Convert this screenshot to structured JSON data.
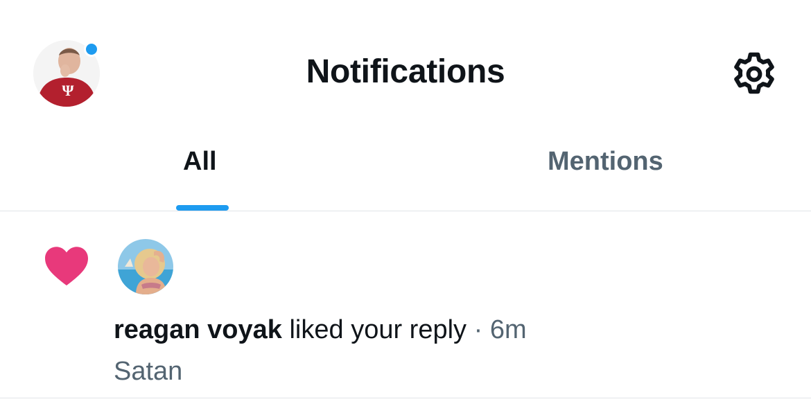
{
  "header": {
    "title": "Notifications",
    "avatar_icon": "user-avatar",
    "settings_icon": "gear-icon"
  },
  "tabs": [
    {
      "label": "All",
      "active": true
    },
    {
      "label": "Mentions",
      "active": false
    }
  ],
  "notifications": [
    {
      "type_icon": "heart-icon",
      "user_name": "reagan voyak",
      "action_text": "liked your reply",
      "separator": "·",
      "time": "6m",
      "reply_text": "Satan"
    }
  ],
  "colors": {
    "accent": "#1d9bf0",
    "like": "#e8397b",
    "text_primary": "#0f1419",
    "text_secondary": "#536471",
    "divider": "#e1e4e8"
  }
}
